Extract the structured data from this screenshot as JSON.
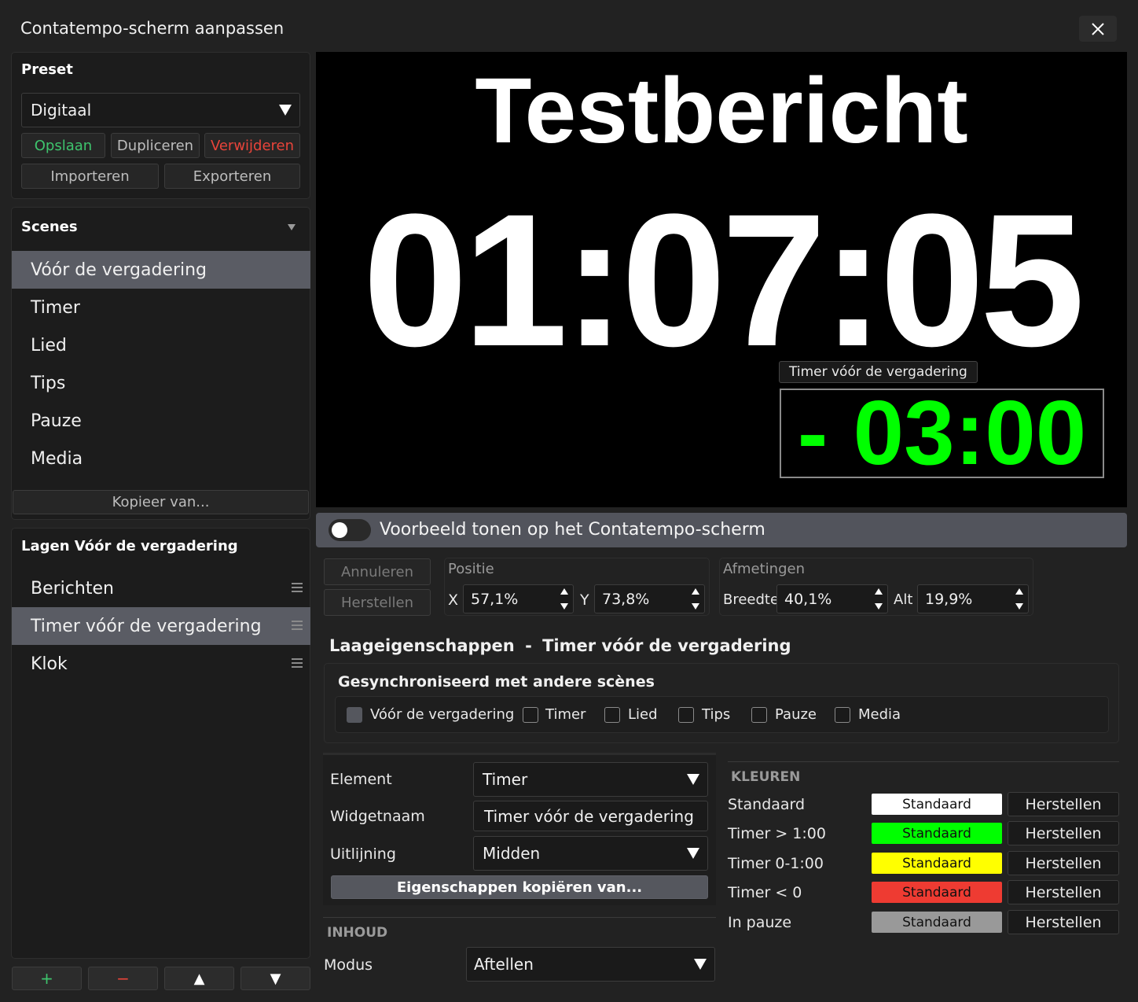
{
  "window": {
    "title": "Contatempo-scherm aanpassen"
  },
  "preset": {
    "heading": "Preset",
    "selected": "Digitaal",
    "save": "Opslaan",
    "duplicate": "Dupliceren",
    "delete": "Verwijderen",
    "import": "Importeren",
    "export": "Exporteren"
  },
  "scenes": {
    "heading": "Scenes",
    "items": [
      "Vóór de vergadering",
      "Timer",
      "Lied",
      "Tips",
      "Pauze",
      "Media"
    ],
    "copy_from": "Kopieer van..."
  },
  "layers": {
    "heading": "Lagen Vóór de vergadering",
    "items": [
      "Berichten",
      "Timer vóór de vergadering",
      "Klok"
    ],
    "add": "+",
    "remove": "−",
    "up": "▲",
    "down": "▼"
  },
  "preview": {
    "message": "Testbericht",
    "clock": "01:07:05",
    "timer_label": "Timer vóór de vergadering",
    "timer_value": "- 03:00",
    "timer_color": "#00ff00"
  },
  "preview_toggle": {
    "label": "Voorbeeld tonen op het Contatempo-scherm",
    "on": false
  },
  "edit": {
    "cancel": "Annuleren",
    "restore": "Herstellen"
  },
  "position": {
    "heading": "Positie",
    "x_label": "X",
    "x": "57,1%",
    "y_label": "Y",
    "y": "73,8%"
  },
  "size": {
    "heading": "Afmetingen",
    "w_label": "Breedte",
    "w": "40,1%",
    "h_label": "Alt",
    "h": "19,9%"
  },
  "layer_props": {
    "heading": "Laageigenschappen",
    "separator": "-",
    "layer_name": "Timer vóór de vergadering",
    "sync_heading": "Gesynchroniseerd met andere scènes",
    "sync": [
      {
        "label": "Vóór de vergadering",
        "checked": true
      },
      {
        "label": "Timer",
        "checked": false
      },
      {
        "label": "Lied",
        "checked": false
      },
      {
        "label": "Tips",
        "checked": false
      },
      {
        "label": "Pauze",
        "checked": false
      },
      {
        "label": "Media",
        "checked": false
      }
    ]
  },
  "element": {
    "element_label": "Element",
    "element_value": "Timer",
    "widget_label": "Widgetnaam",
    "widget_value": "Timer vóór de vergadering",
    "align_label": "Uitlijning",
    "align_value": "Midden",
    "copy_props": "Eigenschappen kopiëren van..."
  },
  "content": {
    "heading": "INHOUD",
    "mode_label": "Modus",
    "mode_value": "Aftellen"
  },
  "colors": {
    "heading": "KLEUREN",
    "rows": [
      {
        "label": "Standaard",
        "value": "Standaard",
        "color": "#ffffff",
        "reset": "Herstellen"
      },
      {
        "label": "Timer > 1:00",
        "value": "Standaard",
        "color": "#00ff00",
        "reset": "Herstellen"
      },
      {
        "label": "Timer 0-1:00",
        "value": "Standaard",
        "color": "#ffff00",
        "reset": "Herstellen"
      },
      {
        "label": "Timer < 0",
        "value": "Standaard",
        "color": "#ee3b32",
        "reset": "Herstellen"
      },
      {
        "label": "In pauze",
        "value": "Standaard",
        "color": "#999999",
        "reset": "Herstellen"
      }
    ]
  },
  "theme": {
    "accent_save": "#3ec46d",
    "accent_delete": "#e8443a",
    "selected_bg": "#5a5c64"
  }
}
